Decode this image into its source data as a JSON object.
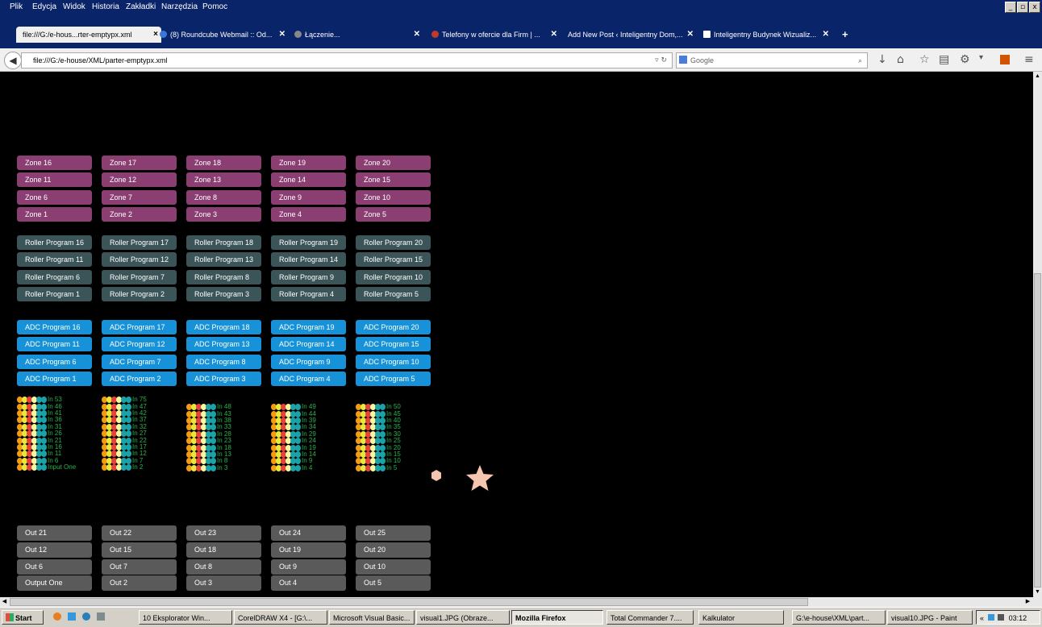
{
  "menu": [
    "Plik",
    "Edycja",
    "Widok",
    "Historia",
    "Zakładki",
    "Narzędzia",
    "Pomoc"
  ],
  "window_controls": [
    "_",
    "▫",
    "x"
  ],
  "tabs": [
    {
      "label": "file:///G:/e-hous...rter-emptypx.xml",
      "active": true
    },
    {
      "label": "(8) Roundcube Webmail :: Od...",
      "active": false
    },
    {
      "label": "Łączenie...",
      "active": false
    },
    {
      "label": "Telefony w ofercie dla Firm | ...",
      "active": false
    },
    {
      "label": "Add New Post ‹ Inteligentny Dom,...",
      "active": false
    },
    {
      "label": "Inteligentny Budynek Wizualiz...",
      "active": false
    }
  ],
  "new_tab": "+",
  "url": "file:///G:/e-house/XML/parter-emptypx.xml",
  "search_placeholder": "Google",
  "zones": [
    [
      "Zone 16",
      "Zone 17",
      "Zone 18",
      "Zone 19",
      "Zone 20"
    ],
    [
      "Zone 11",
      "Zone 12",
      "Zone 13",
      "Zone 14",
      "Zone 15"
    ],
    [
      "Zone 6",
      "Zone 7",
      "Zone 8",
      "Zone 9",
      "Zone 10"
    ],
    [
      "Zone 1",
      "Zone 2",
      "Zone 3",
      "Zone 4",
      "Zone 5"
    ]
  ],
  "rollers": [
    [
      "Roller Program 16",
      "Roller Program 17",
      "Roller Program 18",
      "Roller Program 19",
      "Roller Program 20"
    ],
    [
      "Roller Program 11",
      "Roller Program 12",
      "Roller Program 13",
      "Roller Program 14",
      "Roller Program 15"
    ],
    [
      "Roller Program 6",
      "Roller Program 7",
      "Roller Program 8",
      "Roller Program 9",
      "Roller Program 10"
    ],
    [
      "Roller Program 1",
      "Roller Program 2",
      "Roller Program 3",
      "Roller Program 4",
      "Roller Program 5"
    ]
  ],
  "adcs": [
    [
      "ADC Program 16",
      "ADC Program 17",
      "ADC Program 18",
      "ADC Program 19",
      "ADC Program 20"
    ],
    [
      "ADC Program 11",
      "ADC Program 12",
      "ADC Program 13",
      "ADC Program 14",
      "ADC Program 15"
    ],
    [
      "ADC Program 6",
      "ADC Program 7",
      "ADC Program 8",
      "ADC Program 9",
      "ADC Program 10"
    ],
    [
      "ADC Program 1",
      "ADC Program 2",
      "ADC Program 3",
      "ADC Program 4",
      "ADC Program 5"
    ]
  ],
  "inputs": [
    [
      "In 53",
      "In 46",
      "In 41",
      "In 36",
      "In 31",
      "In 26",
      "In 21",
      "In 16",
      "In 11",
      "In 6",
      "Input One"
    ],
    [
      "In 75",
      "In 47",
      "In 42",
      "In 37",
      "In 32",
      "In 27",
      "In 22",
      "In 17",
      "In 12",
      "In 7",
      "In 2"
    ],
    [
      "In 48",
      "In 43",
      "In 38",
      "In 33",
      "In 28",
      "In 23",
      "In 18",
      "In 13",
      "In 8",
      "In 3"
    ],
    [
      "In 49",
      "In 44",
      "In 39",
      "In 34",
      "In 29",
      "In 24",
      "In 19",
      "In 14",
      "In 9",
      "In 4"
    ],
    [
      "In 50",
      "In 45",
      "In 40",
      "In 35",
      "In 30",
      "In 25",
      "In 20",
      "In 15",
      "In 10",
      "In 5"
    ]
  ],
  "outputs": [
    [
      "Out 21",
      "Out 22",
      "Out 23",
      "Out 24",
      "Out 25"
    ],
    [
      "Out 12",
      "Out 15",
      "Out 18",
      "Out 19",
      "Out 20"
    ],
    [
      "Out 6",
      "Out 7",
      "Out 8",
      "Out 9",
      "Out 10"
    ],
    [
      "Output One",
      "Out 2",
      "Out 3",
      "Out 4",
      "Out 5"
    ]
  ],
  "dot_colors": [
    "#f39c12",
    "#e8e83a",
    "#e8413c",
    "#f7f7a0",
    "#1aa2a8",
    "#1aa2a8"
  ],
  "taskbar": {
    "start": "Start",
    "items": [
      {
        "label": "10 Eksplorator Win...",
        "pressed": false
      },
      {
        "label": "CorelDRAW X4 - [G:\\...",
        "pressed": false
      },
      {
        "label": "Microsoft Visual Basic...",
        "pressed": false
      },
      {
        "label": "visual1.JPG (Obraze...",
        "pressed": false
      },
      {
        "label": "Mozilla Firefox",
        "pressed": true
      },
      {
        "label": "Total Commander 7....",
        "pressed": false
      },
      {
        "label": "Kalkulator",
        "pressed": false
      },
      {
        "label": "G:\\e-house\\XML\\part...",
        "pressed": false
      },
      {
        "label": "visual10.JPG - Paint",
        "pressed": false
      }
    ],
    "tray_arrows": "«",
    "clock": "03:12"
  }
}
